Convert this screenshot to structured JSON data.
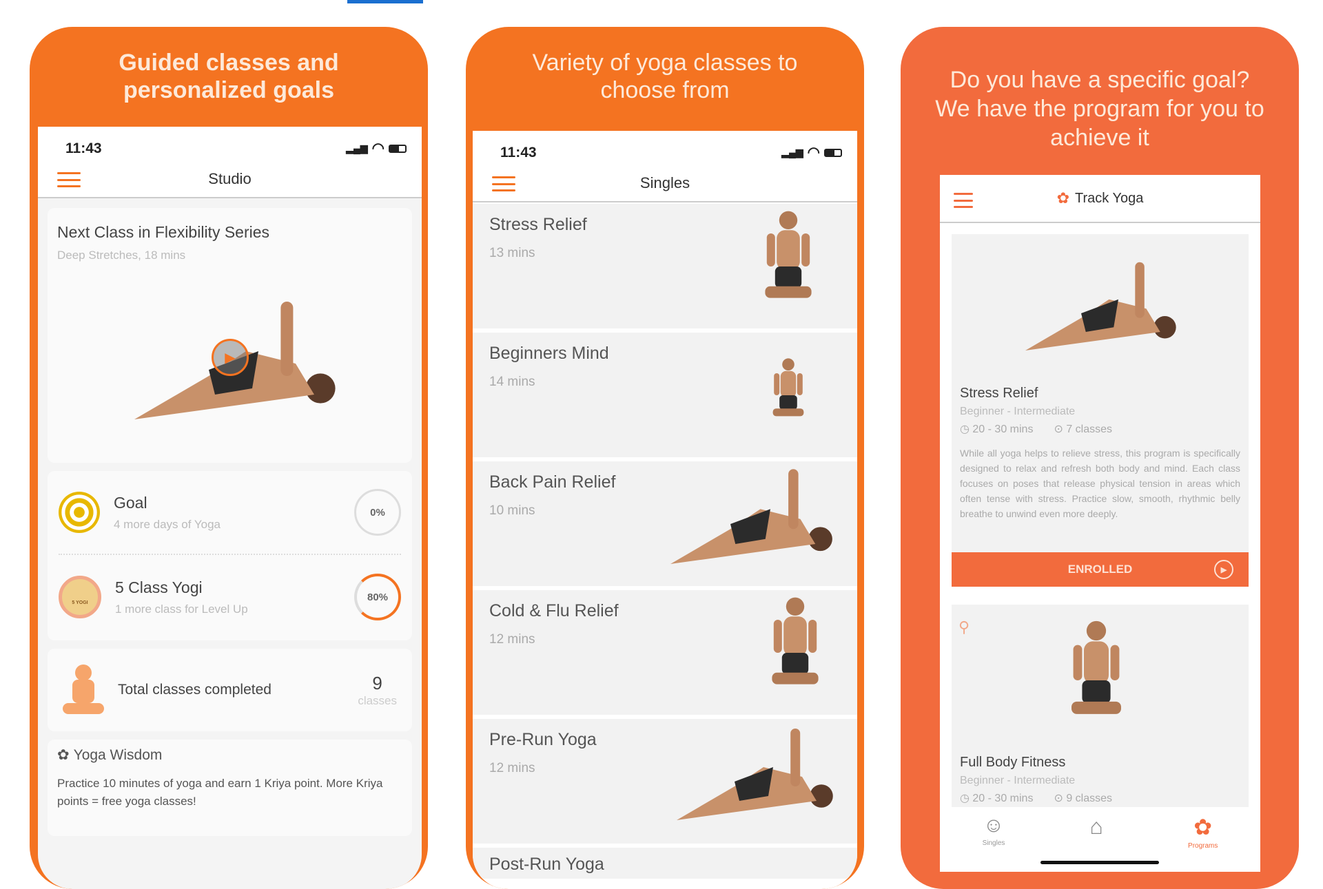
{
  "colors": {
    "accent": "#f47321",
    "accent_coral": "#f26b3d"
  },
  "phones": [
    {
      "promo": [
        "Guided classes and",
        "personalized goals"
      ],
      "time": "11:43",
      "nav_title": "Studio",
      "next_class": {
        "title": "Next Class in Flexibility Series",
        "subtitle": "Deep Stretches, 18 mins"
      },
      "goal": {
        "title": "Goal",
        "subtitle": "4  more days of Yoga",
        "progress": "0%"
      },
      "level": {
        "title": "5 Class Yogi",
        "subtitle": "1 more class for Level Up",
        "progress": "80%",
        "badge": "5 YOGI"
      },
      "total": {
        "label": "Total classes completed",
        "count": "9",
        "unit": "classes"
      },
      "wisdom": {
        "title": "Yoga Wisdom",
        "text": "Practice 10 minutes of yoga and earn 1 Kriya point. More Kriya points = free yoga classes!"
      }
    },
    {
      "promo": [
        "Variety of yoga classes to",
        "choose from"
      ],
      "time": "11:43",
      "nav_title": "Singles",
      "items": [
        {
          "title": "Stress Relief",
          "duration": "13 mins"
        },
        {
          "title": "Beginners Mind",
          "duration": "14 mins"
        },
        {
          "title": "Back Pain Relief",
          "duration": "10 mins"
        },
        {
          "title": "Cold & Flu Relief",
          "duration": "12 mins"
        },
        {
          "title": "Pre-Run Yoga",
          "duration": "12 mins"
        },
        {
          "title": "Post-Run Yoga",
          "duration": ""
        }
      ]
    },
    {
      "promo": [
        "Do you have a specific goal?",
        "We have the program for you to",
        "achieve it"
      ],
      "nav_title": "Track Yoga",
      "program1": {
        "title": "Stress Relief",
        "level": "Beginner - Intermediate",
        "duration": "20 - 30 mins",
        "classes": "7 classes",
        "description": "While all yoga helps to relieve stress, this program is specifically designed to relax and refresh both body and mind. Each class focuses on poses that release physical tension in areas which often tense with stress. Practice slow, smooth, rhythmic belly breathe to unwind even more deeply.",
        "button": "ENROLLED"
      },
      "program2": {
        "title": "Full Body Fitness",
        "level": "Beginner - Intermediate",
        "duration": "20 - 30 mins",
        "classes": "9 classes"
      },
      "tabs": [
        {
          "label": "Singles",
          "icon": "meditation-icon"
        },
        {
          "label": "",
          "icon": "home-icon"
        },
        {
          "label": "Programs",
          "icon": "lotus-icon"
        }
      ]
    }
  ]
}
